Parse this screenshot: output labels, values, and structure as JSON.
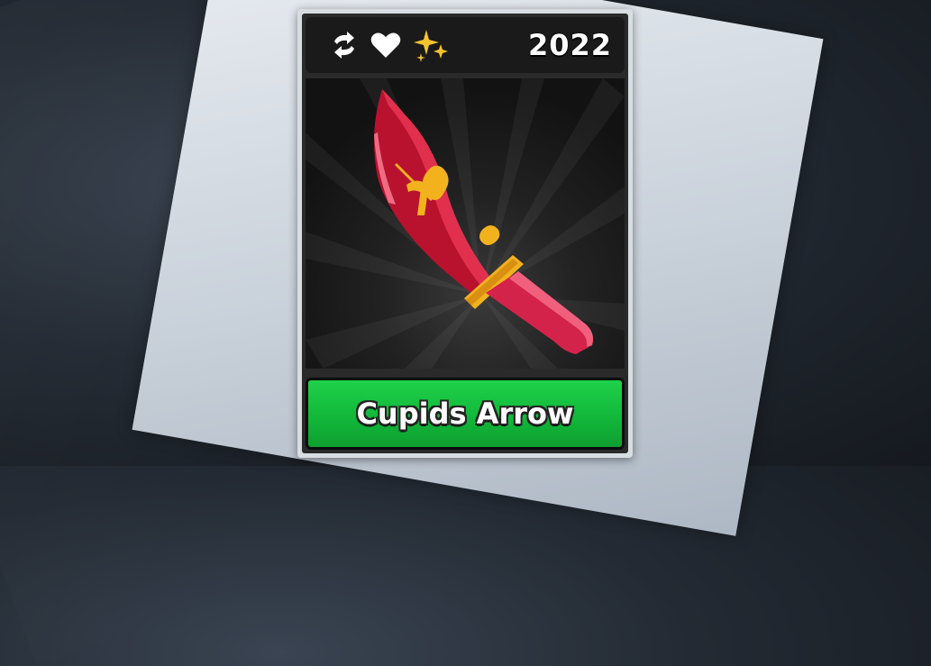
{
  "card": {
    "year": "2022",
    "item_name": "Cupids Arrow",
    "badges": [
      "swap-icon",
      "heart-icon",
      "sparkles-icon"
    ],
    "rarity_color": "#12b83a",
    "blade_color": "#c8163a",
    "accent_color": "#f2b21e"
  }
}
